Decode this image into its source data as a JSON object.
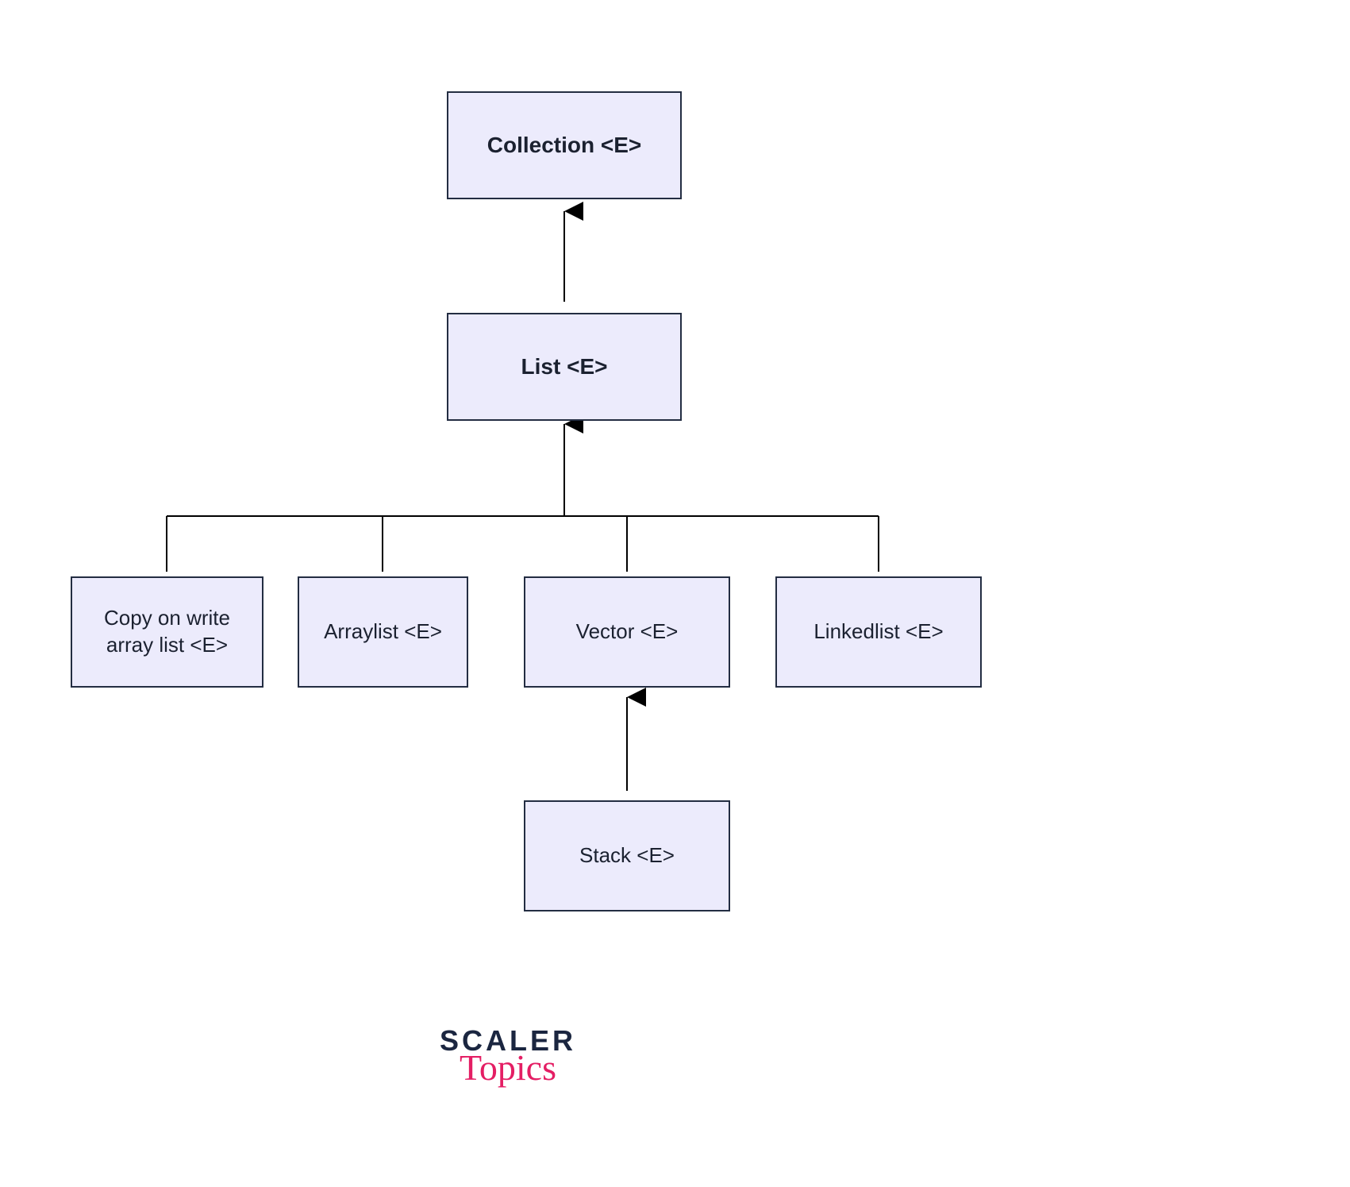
{
  "nodes": {
    "collection": "Collection  <E>",
    "list": "List  <E>",
    "cowal": "Copy on write\narray list  <E>",
    "arraylist": "Arraylist  <E>",
    "vector": "Vector  <E>",
    "linkedlist": "Linkedlist  <E>",
    "stack": "Stack  <E>"
  },
  "logo": {
    "line1": "SCALER",
    "line2": "Topics"
  }
}
